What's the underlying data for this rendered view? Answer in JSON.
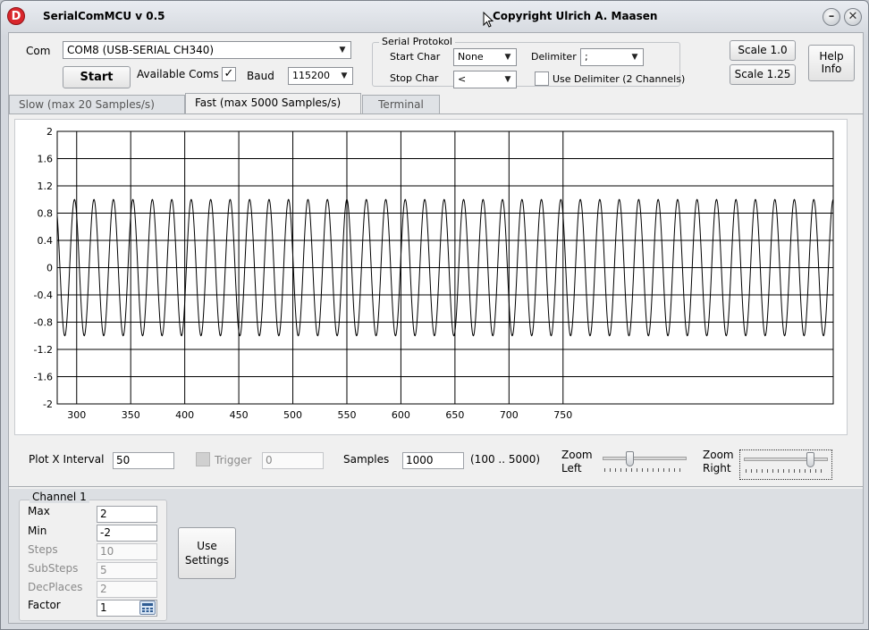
{
  "titlebar": {
    "logo_letter": "D",
    "title": "SerialComMCU   v 0.5",
    "copyright": "Copyright Ulrich A. Maasen",
    "min_symbol": "–",
    "close_symbol": "✕"
  },
  "connection": {
    "com_label": "Com",
    "com_value": "COM8 (USB-SERIAL CH340)",
    "start_label": "Start",
    "available_coms_label": "Available Coms",
    "available_coms_checked": "✓",
    "baud_label": "Baud",
    "baud_value": "115200"
  },
  "serial_protokol": {
    "caption": "Serial Protokol",
    "start_char_label": "Start Char",
    "start_char_value": "None",
    "stop_char_label": "Stop Char",
    "stop_char_value": "<",
    "delimiter_label": "Delimiter",
    "delimiter_value": ";",
    "use_delimiter_label": "Use Delimiter (2 Channels)"
  },
  "scale": {
    "scale_1_label": "Scale 1.0",
    "scale_125_label": "Scale 1.25"
  },
  "help": {
    "line1": "Help",
    "line2": "Info"
  },
  "tabs": [
    {
      "label": "Slow   (max 20 Samples/s)"
    },
    {
      "label": "Fast  (max 5000 Samples/s)"
    },
    {
      "label": "Terminal"
    }
  ],
  "chart_data": {
    "type": "line",
    "title": "",
    "xlabel": "",
    "ylabel": "",
    "xlim": [
      282,
      1000
    ],
    "ylim": [
      -2,
      2
    ],
    "x_ticks": [
      300,
      350,
      400,
      450,
      500,
      550,
      600,
      650,
      700,
      750
    ],
    "x_tick_labels": [
      "300",
      "350",
      "400",
      "450",
      "500",
      "550",
      "600",
      "650",
      "700",
      "750"
    ],
    "y_ticks": [
      2,
      1.6,
      1.2,
      0.8,
      0.4,
      0,
      -0.4,
      -0.8,
      -1.2,
      -1.6,
      -2
    ],
    "y_tick_labels": [
      "2",
      "1.6",
      "1.2",
      "0.8",
      "0.4",
      "0",
      "-0.4",
      "-0.8",
      "-1.2",
      "-1.6",
      "-2"
    ],
    "grid": true,
    "series": [
      {
        "amplitude": 1.0,
        "period": 18,
        "peak_x": 298,
        "x_start": 282,
        "x_end": 1000,
        "color": "#000000"
      }
    ]
  },
  "plot_controls": {
    "plot_x_interval_label": "Plot X Interval",
    "plot_x_interval_value": "50",
    "trigger_label": "Trigger",
    "trigger_value": "0",
    "samples_label": "Samples",
    "samples_value": "1000",
    "samples_range": "(100 .. 5000)",
    "zoom_left_label_1": "Zoom",
    "zoom_left_label_2": "Left",
    "zoom_left_level": 0.3,
    "zoom_right_label_1": "Zoom",
    "zoom_right_label_2": "Right",
    "zoom_right_level": 0.82
  },
  "channel1": {
    "caption": "Channel 1",
    "max_label": "Max",
    "max_value": "2",
    "min_label": "Min",
    "min_value": "-2",
    "steps_label": "Steps",
    "steps_value": "10",
    "substeps_label": "SubSteps",
    "substeps_value": "5",
    "decplaces_label": "DecPlaces",
    "decplaces_value": "2",
    "factor_label": "Factor",
    "factor_value": "1"
  },
  "use_settings": {
    "line1": "Use",
    "line2": "Settings"
  }
}
